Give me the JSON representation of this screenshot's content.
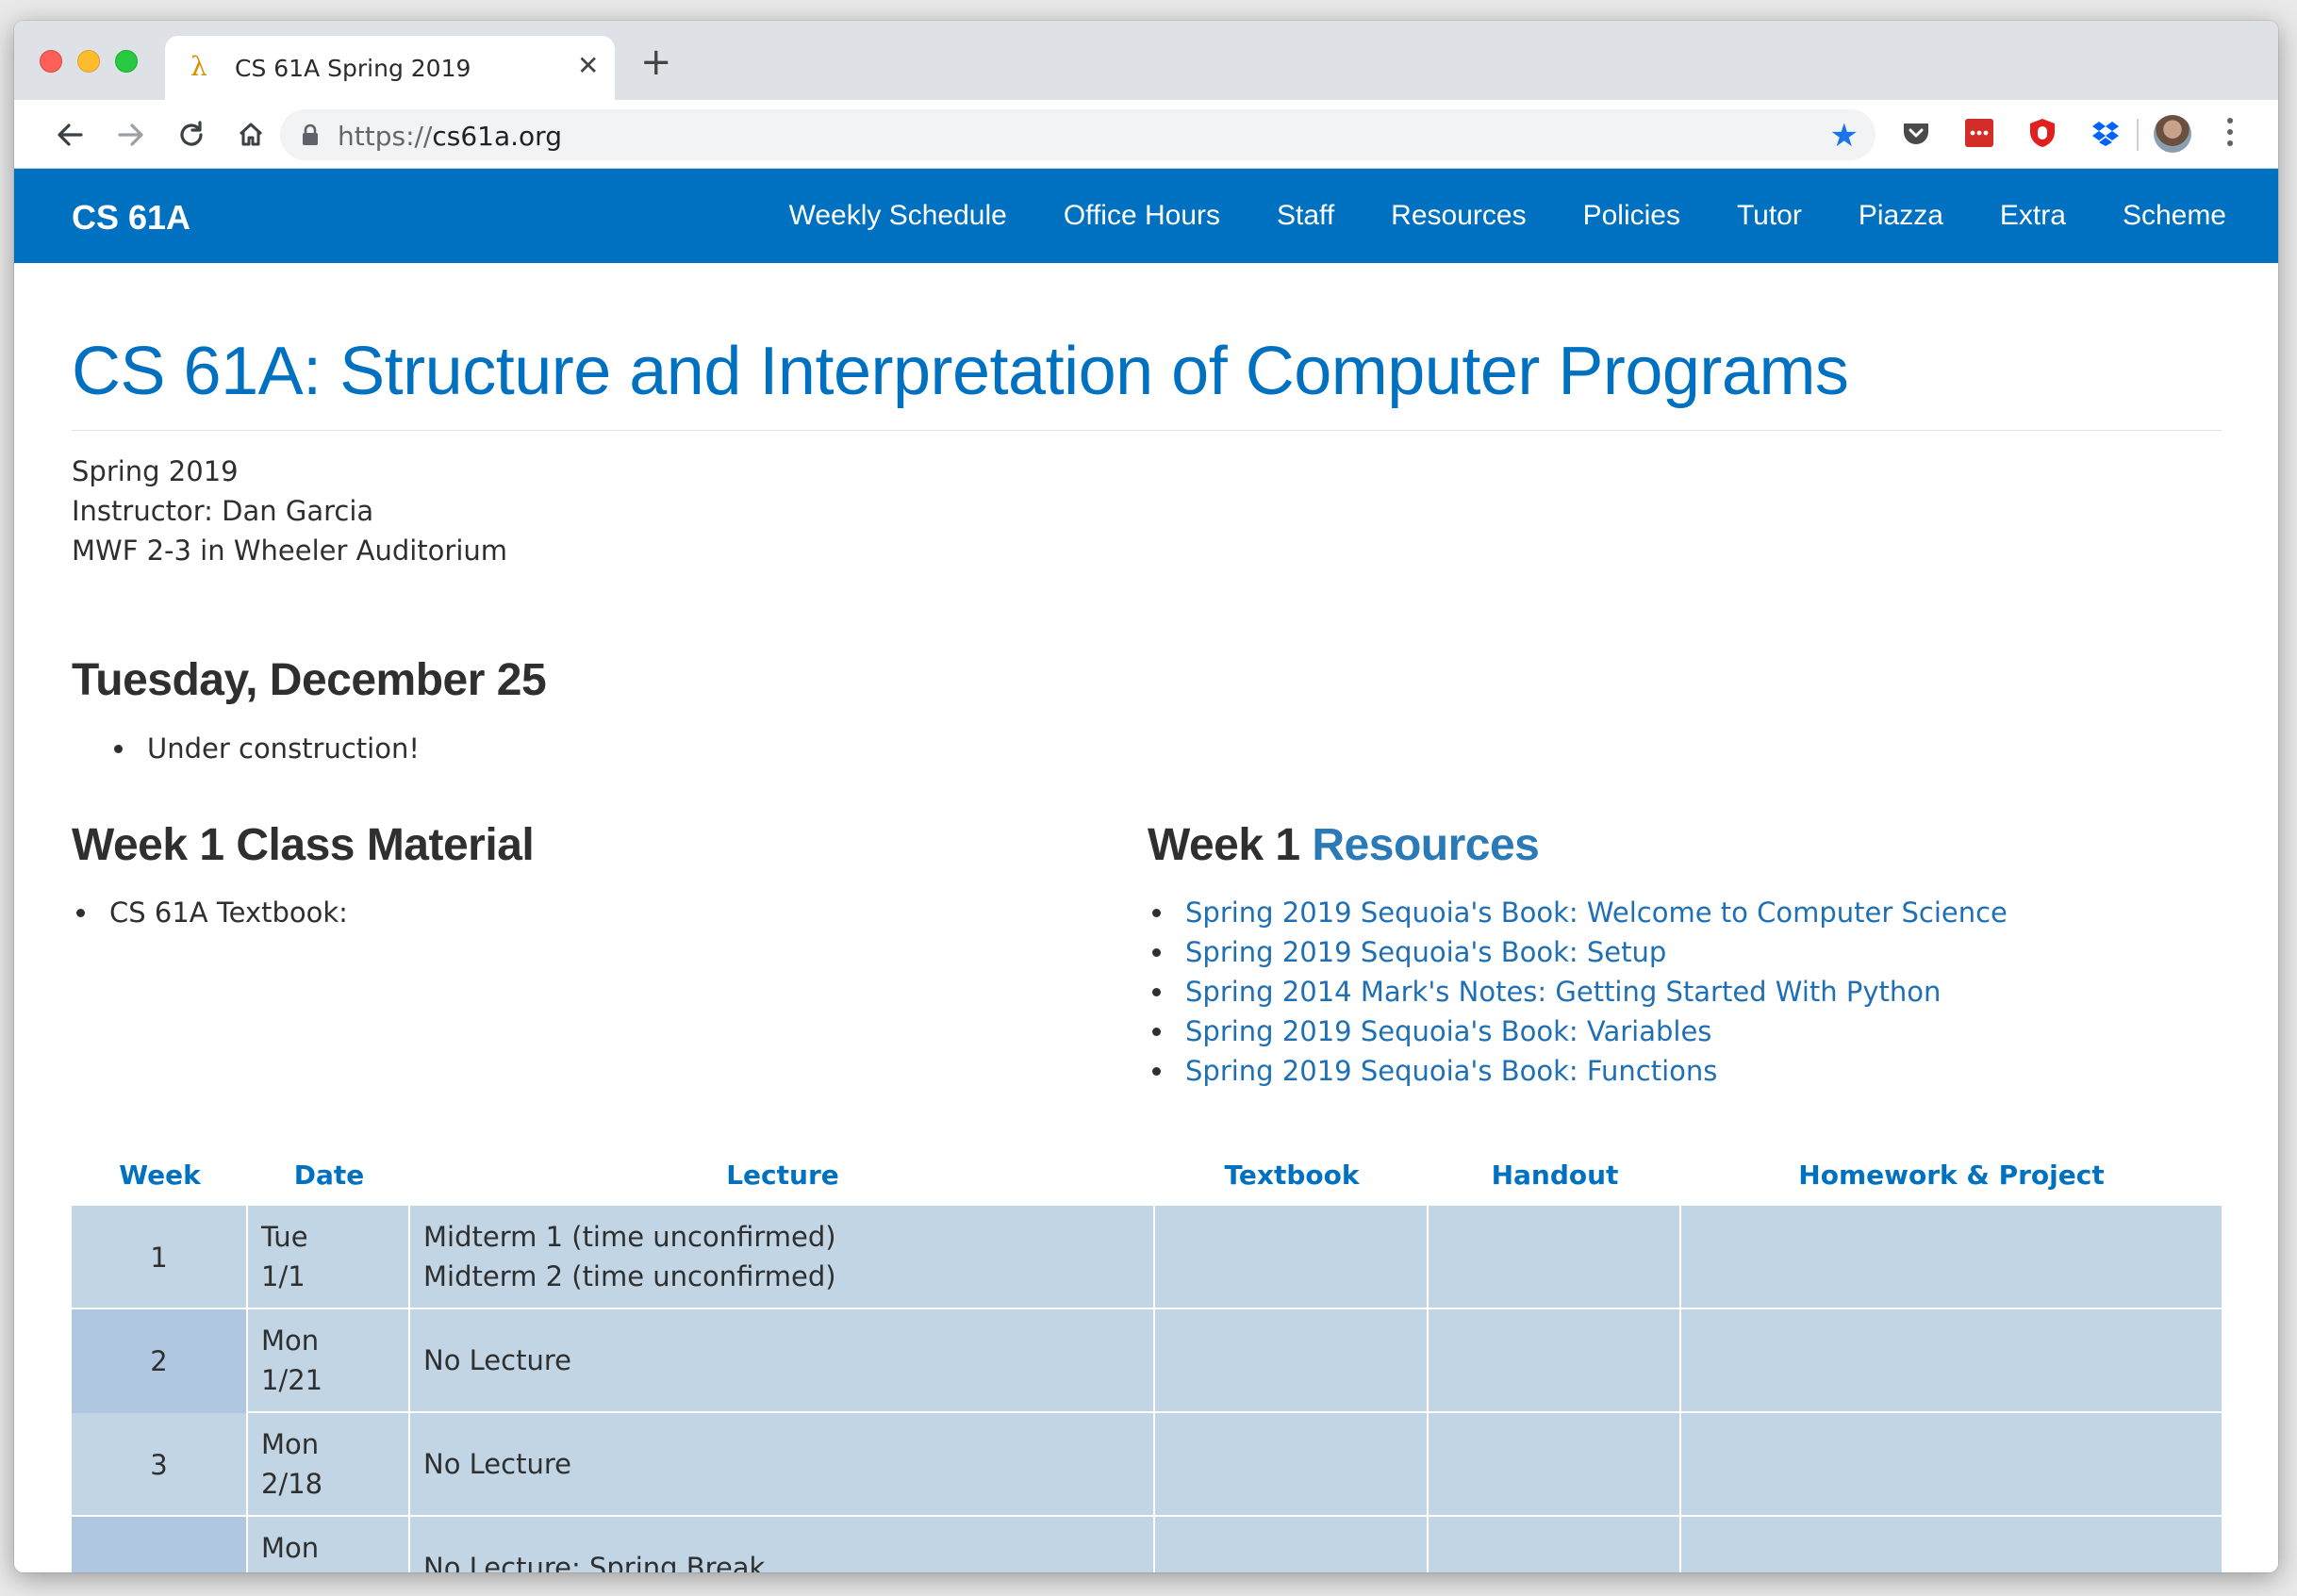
{
  "browser": {
    "tab_title": "CS 61A Spring 2019",
    "tab_favicon": "λ",
    "url_scheme": "https://",
    "url_host": "cs61a.org"
  },
  "site": {
    "brand": "CS 61A",
    "nav": [
      "Weekly Schedule",
      "Office Hours",
      "Staff",
      "Resources",
      "Policies",
      "Tutor",
      "Piazza",
      "Extra",
      "Scheme"
    ],
    "accent_color": "#0070c0"
  },
  "page": {
    "title": "CS 61A: Structure and Interpretation of Computer Programs",
    "info": [
      "Spring 2019",
      "Instructor: Dan Garcia",
      "MWF 2-3 in Wheeler Auditorium"
    ],
    "announcement": {
      "date": "Tuesday, December 25",
      "items": [
        "Under construction!"
      ]
    },
    "week1_material": {
      "heading": "Week 1 Class Material",
      "items": [
        "CS 61A Textbook:"
      ]
    },
    "week1_resources": {
      "heading_prefix": "Week 1 ",
      "heading_link": "Resources",
      "links": [
        "Spring 2019 Sequoia's Book: Welcome to Computer Science",
        "Spring 2019 Sequoia's Book: Setup",
        "Spring 2014 Mark's Notes: Getting Started With Python",
        "Spring 2019 Sequoia's Book: Variables",
        "Spring 2019 Sequoia's Book: Functions"
      ]
    }
  },
  "schedule": {
    "columns": [
      "Week",
      "Date",
      "Lecture",
      "Textbook",
      "Handout",
      "Homework & Project"
    ],
    "rows": [
      {
        "week": "1",
        "day": "Tue",
        "date": "1/1",
        "lecture": [
          "Midterm 1 (time unconfirmed)",
          "Midterm 2 (time unconfirmed)"
        ]
      },
      {
        "week": "2",
        "day": "Mon",
        "date": "1/21",
        "lecture": [
          "No Lecture"
        ]
      },
      {
        "week": "3",
        "day": "Mon",
        "date": "2/18",
        "lecture": [
          "No Lecture"
        ]
      },
      {
        "week": "",
        "day": "Mon",
        "date": "",
        "lecture": [
          "No Lecture: Spring Break"
        ]
      }
    ]
  }
}
